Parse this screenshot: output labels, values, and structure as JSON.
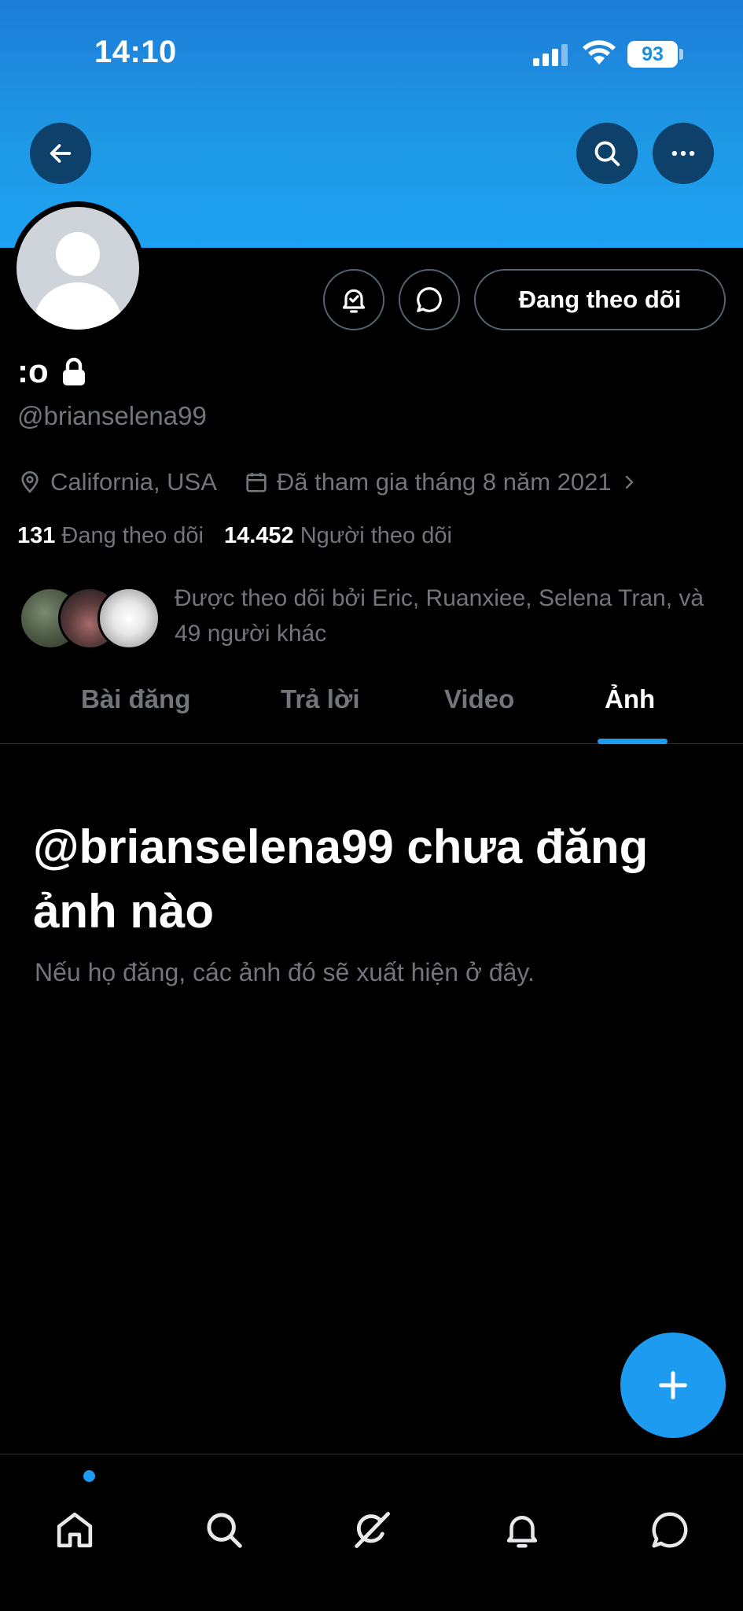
{
  "status_bar": {
    "time": "14:10",
    "battery": "93"
  },
  "profile": {
    "display_name": ":o",
    "handle": "@brianselena99",
    "location": "California, USA",
    "joined": "Đã tham gia tháng 8 năm 2021",
    "following_count": "131",
    "following_label": "Đang theo dõi",
    "followers_count": "14.452",
    "followers_label": "Người theo dõi",
    "followed_by": "Được theo dõi bởi Eric, Ruanxiee, Selena Tran, và 49 người khác"
  },
  "actions": {
    "follow_button": "Đang theo dõi"
  },
  "tabs": [
    {
      "label": "Bài đăng"
    },
    {
      "label": "Trả lời"
    },
    {
      "label": "Video"
    },
    {
      "label": "Ảnh",
      "active": true
    }
  ],
  "empty_state": {
    "title": "@brianselena99 chưa đăng ảnh nào",
    "subtitle": "Nếu họ đăng, các ảnh đó sẽ xuất hiện ở đây."
  },
  "colors": {
    "accent": "#1d9bf0",
    "background": "#000000",
    "muted": "#71767b",
    "banner": "#1da1f2"
  },
  "icons": [
    "back-arrow-icon",
    "search-icon",
    "more-icon",
    "notify-bell-icon",
    "message-icon",
    "lock-icon",
    "location-pin-icon",
    "calendar-icon",
    "chevron-right-icon",
    "plus-icon",
    "home-icon",
    "grok-icon",
    "bell-icon",
    "chat-icon"
  ]
}
